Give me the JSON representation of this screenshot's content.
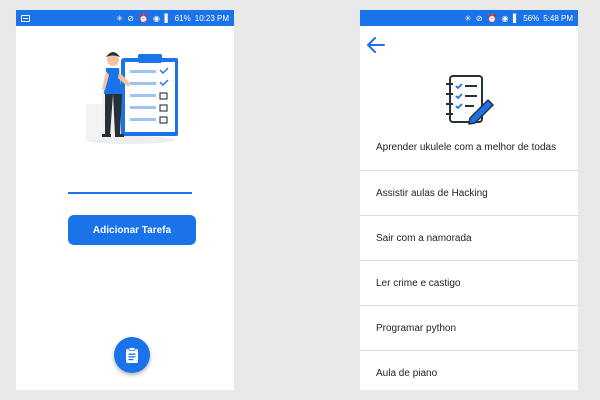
{
  "left_screen": {
    "status_bar": {
      "icons": "✳ ⊘ ⏰ ◉ ▌",
      "battery": "61%",
      "time": "10:23 PM"
    },
    "task_input": {
      "value": "",
      "placeholder": ""
    },
    "add_button_label": "Adicionar Tarefa",
    "fab_icon": "clipboard-icon"
  },
  "right_screen": {
    "status_bar": {
      "icons": "✳ ⊘ ⏰ ◉ ▌",
      "battery": "56%",
      "time": "5:48 PM"
    },
    "header_icon": "checklist-icon",
    "tasks": [
      "Aprender ukulele com a melhor de todas",
      "Assistir aulas de Hacking",
      "Sair com a namorada",
      "Ler crime e castigo",
      "Programar python",
      "Aula de piano"
    ]
  },
  "colors": {
    "accent": "#1a73e8",
    "background": "#e9e9e9",
    "divider": "#dcdcdc"
  }
}
